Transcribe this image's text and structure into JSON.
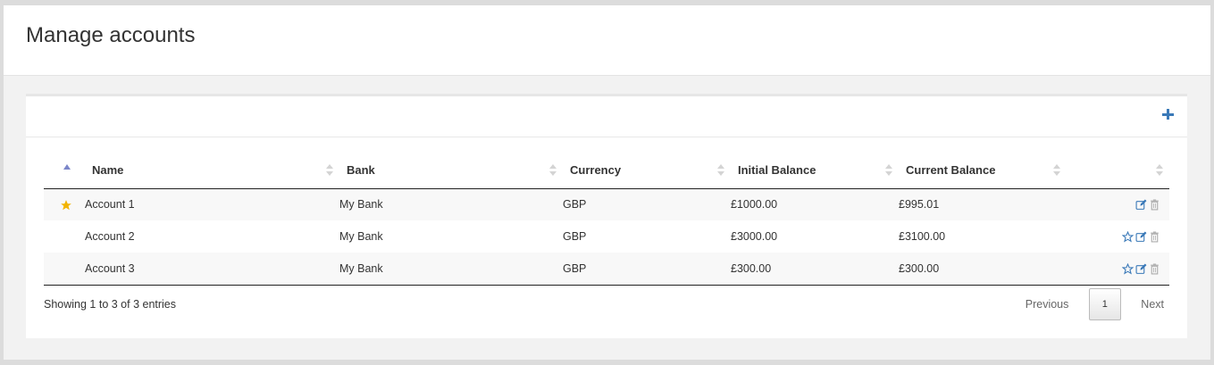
{
  "page": {
    "title": "Manage accounts"
  },
  "toolbar": {
    "add_icon": "plus-icon",
    "add_color": "#3a79b8"
  },
  "table": {
    "columns": [
      "",
      "Name",
      "Bank",
      "Currency",
      "Initial Balance",
      "Current Balance",
      ""
    ],
    "rows": [
      {
        "favorite": true,
        "name": "Account 1",
        "bank": "My Bank",
        "currency": "GBP",
        "initial": "£1000.00",
        "current": "£995.01"
      },
      {
        "favorite": false,
        "name": "Account 2",
        "bank": "My Bank",
        "currency": "GBP",
        "initial": "£3000.00",
        "current": "£3100.00"
      },
      {
        "favorite": false,
        "name": "Account 3",
        "bank": "My Bank",
        "currency": "GBP",
        "initial": "£300.00",
        "current": "£300.00"
      }
    ]
  },
  "footer": {
    "info": "Showing 1 to 3 of 3 entries",
    "previous": "Previous",
    "page": "1",
    "next": "Next"
  },
  "colors": {
    "star": "#f2b400",
    "icon": "#3a79b8",
    "trash": "#aaaaaa"
  }
}
